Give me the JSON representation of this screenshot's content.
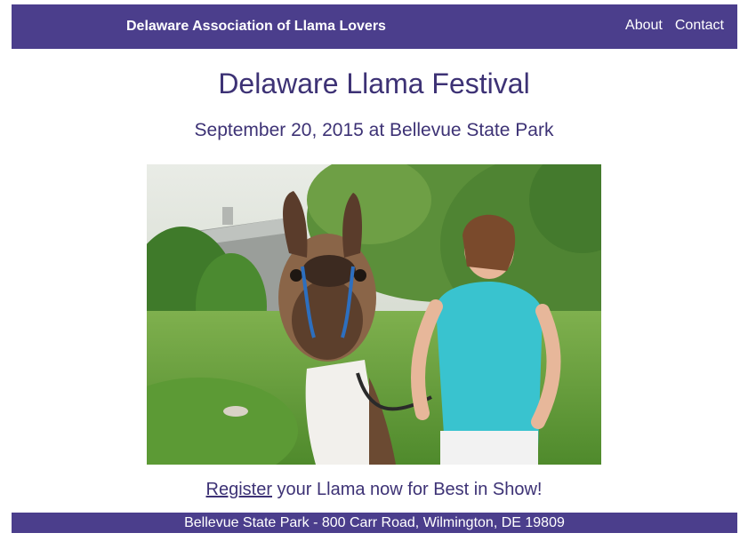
{
  "header": {
    "brand": "Delaware Association of Llama Lovers",
    "nav": [
      {
        "label": "About"
      },
      {
        "label": "Contact"
      }
    ]
  },
  "main": {
    "title": "Delaware Llama Festival",
    "subtitle": "September 20, 2015 at Bellevue State Park",
    "photo": {
      "alt": "A llama on a lead looking into the camera beside a laughing woman in a turquoise top"
    },
    "cta": {
      "link_label": "Register",
      "rest": " your Llama now for Best in Show!"
    }
  },
  "footer": {
    "address": "Bellevue State Park - 800 Carr Road, Wilmington, DE 19809"
  },
  "colors": {
    "brand_purple": "#4b3e8c",
    "heading_text": "#3d3275"
  }
}
